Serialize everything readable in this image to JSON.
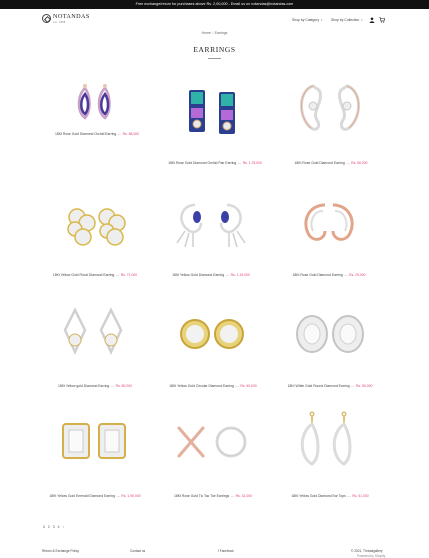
{
  "announcement": "Free exchange/return for purchases above Rs. 2,00,000 - Email us on notandas@notandas.com",
  "brand": {
    "name": "NOTANDAS",
    "tagline": "est. 1888"
  },
  "nav": {
    "category_label": "Shop by Category",
    "collection_label": "Shop by Collection"
  },
  "header_icons": {
    "account": "user-icon",
    "cart": "cart-icon"
  },
  "breadcrumb": {
    "home": "Home",
    "separator": "/",
    "current": "Earrings"
  },
  "page_title": "EARRINGS",
  "products": [
    {
      "name": "18Kt Rose Gold Diamond Orchid Earring",
      "price": "Rs. 88,000"
    },
    {
      "name": "18Kt Rose Gold Diamond Orchid Pair Earring",
      "price": "Rs. 1,76,000"
    },
    {
      "name": "18Kt Rose Gold Diamond Earring",
      "price": "Rs. 66,000"
    },
    {
      "name": "18Kt Yellow Gold Floral Diamond Earring",
      "price": "Rs. 71,000"
    },
    {
      "name": "18Kt Yellow Gold Diamond Earring",
      "price": "Rs. 1,15,000"
    },
    {
      "name": "18Kt Rose Gold Diamond Earring",
      "price": "Rs. 25,000"
    },
    {
      "name": "18Kt Yellow gold Diamond Earring",
      "price": "Rs. 80,000"
    },
    {
      "name": "18Kt Yellow Gold Circular Diamond Earring",
      "price": "Rs. 60,000"
    },
    {
      "name": "18Kt White Gold Round Diamond Earring",
      "price": "Rs. 95,000"
    },
    {
      "name": "18Kt Yellow Gold Emerald Diamond Earring",
      "price": "Rs. 1,90,000"
    },
    {
      "name": "18Kt Rose Gold Tic Tac Toe Earrings",
      "price": "Rs. 31,000"
    },
    {
      "name": "18Kt Yellow Gold Diamond Ear Tops",
      "price": "Rs. 51,000"
    }
  ],
  "price_separator": "—",
  "pagination": {
    "pages": [
      "1",
      "2",
      "3",
      "4"
    ],
    "current": "1",
    "next": "›"
  },
  "footer": {
    "links": [
      "Return & Exchange Policy",
      "Contact us",
      "Facebook"
    ],
    "copyright": "© 2021, Threadgallery",
    "powered": "Powered by Shopify"
  },
  "colors": {
    "price": "#e0457b",
    "announcement_bg": "#111111"
  }
}
